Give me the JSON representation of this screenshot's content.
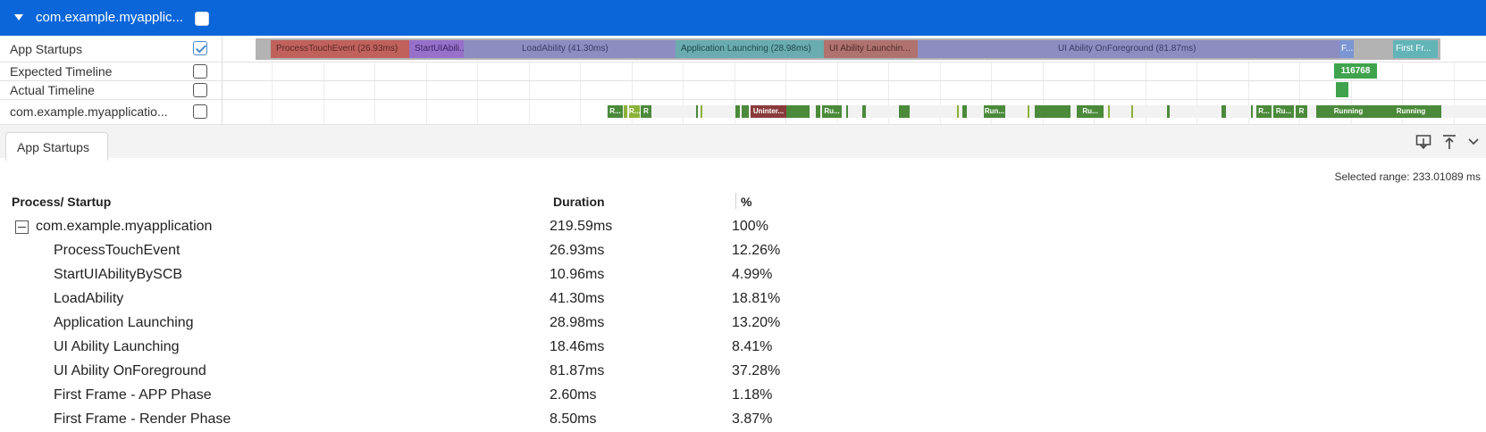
{
  "header": {
    "title": "com.example.myapplic..."
  },
  "lanes": {
    "app_startups": "App Startups",
    "expected": "Expected Timeline",
    "actual": "Actual Timeline",
    "thread": "com.example.myapplicatio..."
  },
  "startup_segments": [
    {
      "label": "ProcessTouchEvent (26.93ms)",
      "color": "#c0615c"
    },
    {
      "label": "StartUIAbili...",
      "color": "#9670c9"
    },
    {
      "label": "LoadAbility (41.30ms)",
      "color": "#8d8dc2"
    },
    {
      "label": "Application Launching (28.98ms)",
      "color": "#6aacb0"
    },
    {
      "label": "UI Ability Launchin...",
      "color": "#b0726f"
    },
    {
      "label": "UI Ability OnForeground (81.87ms)",
      "color": "#8d8dc2"
    },
    {
      "label": "F...",
      "color": "#7b96d3"
    },
    {
      "label": "First Fr...",
      "color": "#62b4b7"
    }
  ],
  "expected_frame": {
    "label": "116768",
    "color": "#3fa34d"
  },
  "thread_labels": {
    "r1": "R...",
    "r2": "R...",
    "r3": "R",
    "unint": "Uninter...",
    "ru1": "Ru...",
    "run1": "Run...",
    "ru2": "Ru...",
    "r4": "R...",
    "ru3": "Ru...",
    "r5": "R",
    "running1": "Running",
    "running2": "Running"
  },
  "tabs": {
    "app_startups": "App Startups"
  },
  "toolbar": {
    "download_icon": "download-icon",
    "upload_icon": "upload-to-top-icon",
    "chevron_icon": "chevron-down-icon"
  },
  "selected_range": "Selected range: 233.01089 ms",
  "table": {
    "headers": {
      "name": "Process/ Startup",
      "duration": "Duration",
      "percent": "%"
    },
    "parent": {
      "name": "com.example.myapplication",
      "duration": "219.59ms",
      "percent": "100%"
    },
    "rows": [
      {
        "name": "ProcessTouchEvent",
        "duration": "26.93ms",
        "percent": "12.26%"
      },
      {
        "name": "StartUIAbilityBySCB",
        "duration": "10.96ms",
        "percent": "4.99%"
      },
      {
        "name": "LoadAbility",
        "duration": "41.30ms",
        "percent": "18.81%"
      },
      {
        "name": "Application Launching",
        "duration": "28.98ms",
        "percent": "13.20%"
      },
      {
        "name": "UI Ability Launching",
        "duration": "18.46ms",
        "percent": "8.41%"
      },
      {
        "name": "UI Ability OnForeground",
        "duration": "81.87ms",
        "percent": "37.28%"
      },
      {
        "name": "First Frame - APP Phase",
        "duration": "2.60ms",
        "percent": "1.18%"
      },
      {
        "name": "First Frame - Render Phase",
        "duration": "8.50ms",
        "percent": "3.87%"
      }
    ]
  },
  "colors": {
    "accent": "#0a66d9",
    "thread_green": "#4a8a3a",
    "light_green": "#8bb23a"
  }
}
